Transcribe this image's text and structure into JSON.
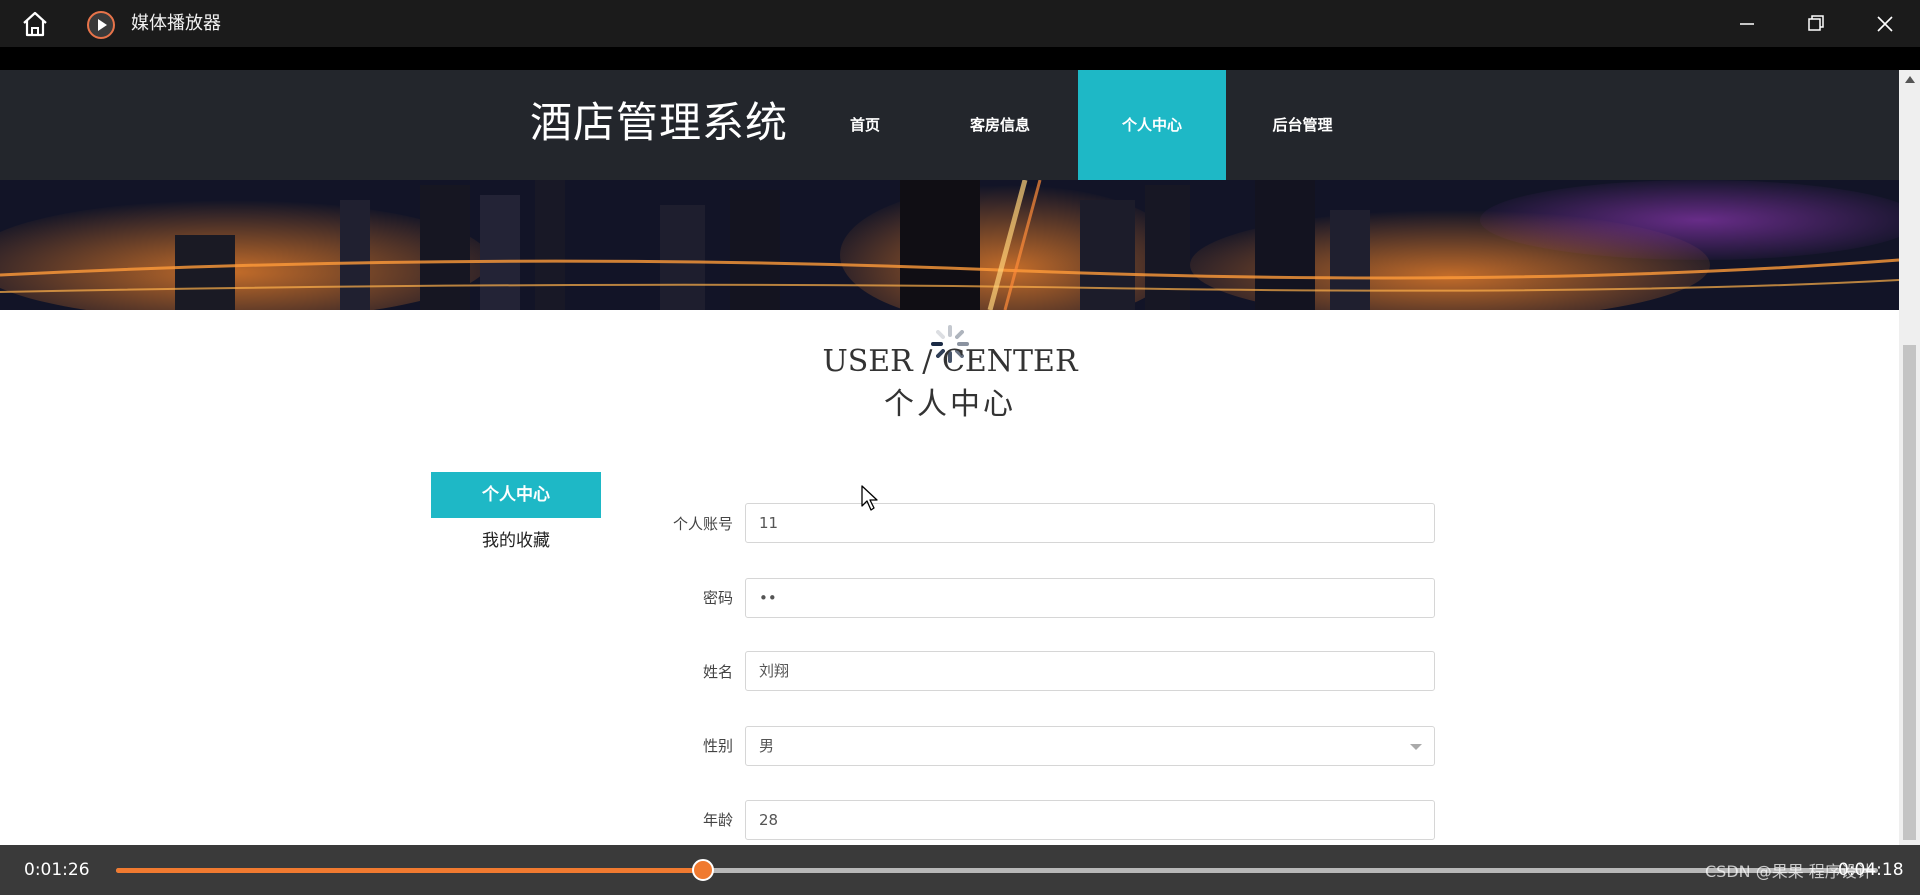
{
  "player": {
    "app_title": "媒体播放器",
    "current_time": "0:01:26",
    "total_time": "0:04:18",
    "progress": 0.333,
    "watermark": "CSDN @果果  程序设计",
    "accent_color": "#f07a30"
  },
  "site": {
    "brand": "酒店管理系统",
    "nav": {
      "home": "首页",
      "rooms": "客房信息",
      "center": "个人中心",
      "admin": "后台管理"
    },
    "accent_color": "#1eb8c6"
  },
  "content": {
    "heading_en": "USER / CENTER",
    "heading_cn": "个人中心"
  },
  "sidebar": {
    "items": [
      {
        "label": "个人中心",
        "active": true
      },
      {
        "label": "我的收藏",
        "active": false
      }
    ]
  },
  "form": {
    "fields": [
      {
        "label": "个人账号",
        "value": "11"
      },
      {
        "label": "密码",
        "value": "••"
      },
      {
        "label": "姓名",
        "value": "刘翔"
      },
      {
        "label": "性别",
        "value": "男"
      },
      {
        "label": "年龄",
        "value": "28"
      }
    ]
  },
  "icons": {
    "home": "home-icon",
    "app": "play-circle-icon",
    "minimize": "minimize-icon",
    "maximize": "restore-icon",
    "close": "close-icon",
    "loader": "loading-spinner-icon",
    "cursor": "mouse-cursor-icon",
    "dropdown": "chevron-down-icon"
  }
}
